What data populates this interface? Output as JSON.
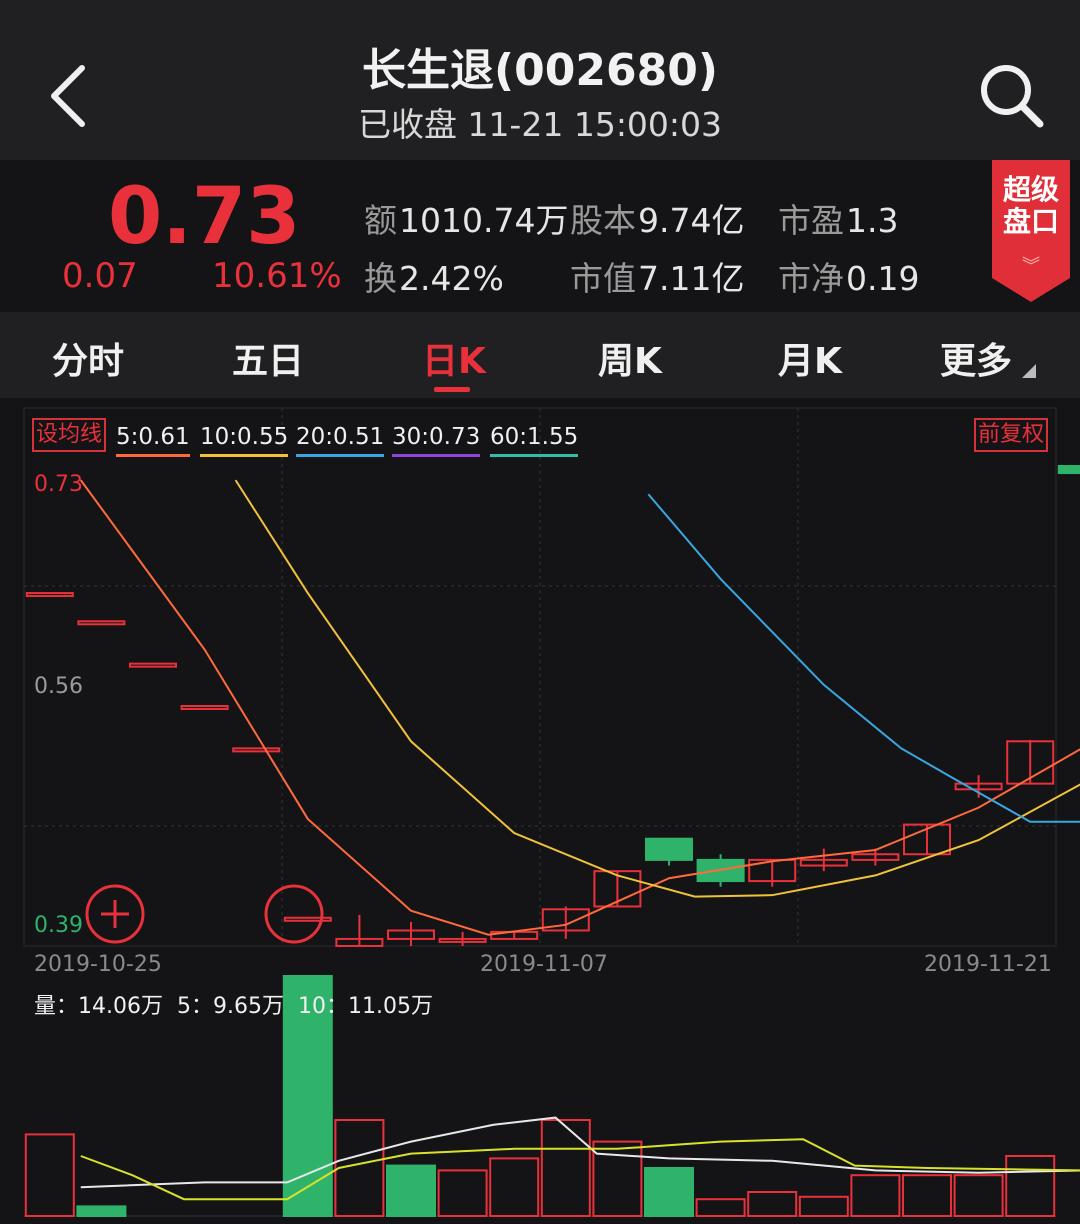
{
  "header": {
    "title": "长生退(002680)",
    "subtitle": "已收盘 11-21 15:00:03"
  },
  "quote": {
    "price": "0.73",
    "change": "0.07",
    "change_pct": "10.61%",
    "stats": [
      {
        "label": "额",
        "value": "1010.74万"
      },
      {
        "label": "股本",
        "value": "9.74亿"
      },
      {
        "label": "市盈",
        "value": "1.3"
      },
      {
        "label": "换",
        "value": "2.42%"
      },
      {
        "label": "市值",
        "value": "7.11亿"
      },
      {
        "label": "市净",
        "value": "0.19"
      }
    ],
    "super_button": "超级\n盘口"
  },
  "tabs": [
    {
      "label": "分时",
      "active": false
    },
    {
      "label": "五日",
      "active": false
    },
    {
      "label": "日K",
      "active": true
    },
    {
      "label": "周K",
      "active": false
    },
    {
      "label": "月K",
      "active": false
    },
    {
      "label": "更多",
      "active": false
    }
  ],
  "colors": {
    "up": "#e8313b",
    "down": "#2fb36a",
    "ma5": "#ff6a3d",
    "ma10": "#f0c23a",
    "ma20": "#3aa6e0",
    "ma30": "#8e44d9",
    "ma60": "#2fbfa6"
  },
  "chart_data": {
    "type": "candlestick",
    "ma_button": "设均线",
    "adjust_button": "前复权",
    "ma_legend": [
      {
        "label": "5:0.61",
        "color": "#ff6a3d"
      },
      {
        "label": "10:0.55",
        "color": "#f0c23a"
      },
      {
        "label": "20:0.51",
        "color": "#3aa6e0"
      },
      {
        "label": "30:0.73",
        "color": "#8e44d9"
      },
      {
        "label": "60:1.55",
        "color": "#2fbfa6"
      }
    ],
    "y_ticks": [
      "0.73",
      "0.56",
      "0.39"
    ],
    "ylim": [
      0.39,
      0.73
    ],
    "x_ticks": [
      "2019-10-25",
      "2019-11-07",
      "2019-11-21"
    ],
    "volume_legend": {
      "vol": "14.06万",
      "ma5": "9.65万",
      "ma10": "11.05万"
    },
    "candles": [
      {
        "o": 0.64,
        "h": 0.64,
        "l": 0.64,
        "c": 0.64
      },
      {
        "o": 0.62,
        "h": 0.62,
        "l": 0.62,
        "c": 0.62
      },
      {
        "o": 0.59,
        "h": 0.59,
        "l": 0.59,
        "c": 0.59
      },
      {
        "o": 0.56,
        "h": 0.56,
        "l": 0.56,
        "c": 0.56
      },
      {
        "o": 0.53,
        "h": 0.53,
        "l": 0.53,
        "c": 0.53
      },
      {
        "o": 0.41,
        "h": 0.41,
        "l": 0.41,
        "c": 0.41
      },
      {
        "o": 0.39,
        "h": 0.412,
        "l": 0.39,
        "c": 0.395
      },
      {
        "o": 0.395,
        "h": 0.407,
        "l": 0.39,
        "c": 0.401
      },
      {
        "o": 0.395,
        "h": 0.4,
        "l": 0.39,
        "c": 0.395
      },
      {
        "o": 0.395,
        "h": 0.401,
        "l": 0.395,
        "c": 0.4
      },
      {
        "o": 0.401,
        "h": 0.418,
        "l": 0.395,
        "c": 0.416
      },
      {
        "o": 0.418,
        "h": 0.443,
        "l": 0.418,
        "c": 0.443
      },
      {
        "o": 0.466,
        "h": 0.466,
        "l": 0.447,
        "c": 0.451
      },
      {
        "o": 0.451,
        "h": 0.455,
        "l": 0.432,
        "c": 0.436
      },
      {
        "o": 0.436,
        "h": 0.451,
        "l": 0.432,
        "c": 0.451
      },
      {
        "o": 0.447,
        "h": 0.459,
        "l": 0.443,
        "c": 0.451
      },
      {
        "o": 0.451,
        "h": 0.459,
        "l": 0.447,
        "c": 0.455
      },
      {
        "o": 0.455,
        "h": 0.476,
        "l": 0.455,
        "c": 0.476
      },
      {
        "o": 0.501,
        "h": 0.511,
        "l": 0.495,
        "c": 0.505
      },
      {
        "o": 0.505,
        "h": 0.536,
        "l": 0.505,
        "c": 0.535
      },
      {
        "o": 0.73,
        "h": 0.73,
        "l": 0.715,
        "c": 0.725
      }
    ],
    "ma_lines": {
      "ma5": [
        [
          0.6,
          0.72
        ],
        [
          3,
          0.6
        ],
        [
          5,
          0.48
        ],
        [
          7,
          0.415
        ],
        [
          8.5,
          0.398
        ],
        [
          10,
          0.405
        ],
        [
          12,
          0.438
        ],
        [
          14,
          0.45
        ],
        [
          16,
          0.458
        ],
        [
          18,
          0.488
        ],
        [
          20,
          0.53
        ]
      ],
      "ma10": [
        [
          3.6,
          0.72
        ],
        [
          5,
          0.64
        ],
        [
          7,
          0.535
        ],
        [
          9,
          0.47
        ],
        [
          11,
          0.44
        ],
        [
          12.5,
          0.425
        ],
        [
          14,
          0.426
        ],
        [
          16,
          0.44
        ],
        [
          18,
          0.465
        ],
        [
          20,
          0.505
        ]
      ],
      "ma20": [
        [
          11.6,
          0.71
        ],
        [
          13,
          0.65
        ],
        [
          15,
          0.575
        ],
        [
          16.5,
          0.53
        ],
        [
          17.5,
          0.509
        ],
        [
          19,
          0.478
        ],
        [
          20,
          0.478
        ]
      ]
    },
    "volume": [
      {
        "v": 0.34,
        "up": true
      },
      {
        "v": 0.04,
        "up": false
      },
      {
        "v": 0,
        "up": false
      },
      {
        "v": 0,
        "up": false
      },
      {
        "v": 0,
        "up": false
      },
      {
        "v": 1.0,
        "up": false
      },
      {
        "v": 0.4,
        "up": true
      },
      {
        "v": 0.21,
        "up": false
      },
      {
        "v": 0.19,
        "up": true
      },
      {
        "v": 0.24,
        "up": true
      },
      {
        "v": 0.4,
        "up": true
      },
      {
        "v": 0.31,
        "up": true
      },
      {
        "v": 0.2,
        "up": false
      },
      {
        "v": 0.07,
        "up": true
      },
      {
        "v": 0.1,
        "up": true
      },
      {
        "v": 0.08,
        "up": true
      },
      {
        "v": 0.17,
        "up": true
      },
      {
        "v": 0.17,
        "up": true
      },
      {
        "v": 0.17,
        "up": true
      },
      {
        "v": 0.25,
        "up": true
      }
    ],
    "volume_lines": {
      "white": [
        [
          0.6,
          0.12
        ],
        [
          3,
          0.14
        ],
        [
          4.6,
          0.14
        ],
        [
          5.6,
          0.23
        ],
        [
          7,
          0.31
        ],
        [
          8.6,
          0.38
        ],
        [
          9.8,
          0.41
        ],
        [
          10.6,
          0.26
        ],
        [
          12,
          0.24
        ],
        [
          14,
          0.23
        ],
        [
          16,
          0.19
        ],
        [
          18,
          0.18
        ],
        [
          20,
          0.19
        ]
      ],
      "yellow": [
        [
          0.6,
          0.25
        ],
        [
          1.6,
          0.17
        ],
        [
          2.6,
          0.07
        ],
        [
          4.6,
          0.07
        ],
        [
          5.6,
          0.2
        ],
        [
          7,
          0.26
        ],
        [
          9,
          0.28
        ],
        [
          11,
          0.28
        ],
        [
          13,
          0.31
        ],
        [
          14.6,
          0.32
        ],
        [
          15.6,
          0.21
        ],
        [
          17,
          0.2
        ],
        [
          20,
          0.19
        ]
      ]
    }
  }
}
